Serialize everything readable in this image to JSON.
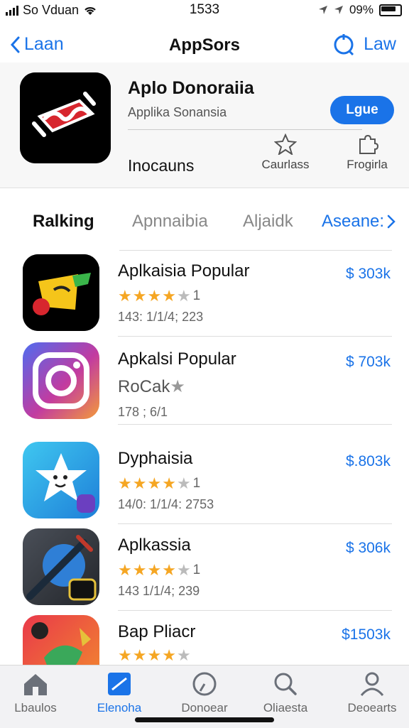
{
  "status_bar": {
    "carrier": "So Vduan",
    "time": "1533",
    "battery_percent": "09%"
  },
  "nav": {
    "back_label": "Laan",
    "title": "AppSors",
    "action_label": "Law"
  },
  "app": {
    "name": "Aplo Donoraiia",
    "subtitle": "Applika Sonansia",
    "get_label": "Lgue",
    "category": "Inocauns",
    "actions": [
      {
        "label": "Caurlass",
        "icon": "star-outline-icon"
      },
      {
        "label": "Frogirla",
        "icon": "puzzle-icon"
      }
    ]
  },
  "tabs": {
    "active": "Ralking",
    "tab2": "Apnnaibia",
    "tab3": "Aljaidk",
    "more": "Aseane:"
  },
  "list": [
    {
      "name": "Aplkaisia Popular",
      "stars": 4,
      "rating_count": "1",
      "meta": "143: 1/1/4; 223",
      "price": "$ 303k",
      "icon": "banana-icon"
    },
    {
      "name": "Apkalsi Popular",
      "subtitle": "RoCak",
      "meta": "178 ; 6/1",
      "price": "$ 703k",
      "icon": "camera-icon"
    },
    {
      "name": "Dyphaisia",
      "stars": 4,
      "rating_count": "1",
      "meta": "14/0: 1/1/4: 2753",
      "price": "$.803k",
      "icon": "star-creature-icon"
    },
    {
      "name": "Aplkassia",
      "stars": 4,
      "rating_count": "1",
      "meta": "143 1/1/4; 239",
      "price": "$ 306k",
      "icon": "knife-icon"
    },
    {
      "name": "Bap Pliacr",
      "stars": 4,
      "rating_count": "",
      "meta": "",
      "price": "$1503k",
      "icon": "gift-icon"
    }
  ],
  "tab_bar": [
    {
      "label": "Lbaulos",
      "icon": "house-icon"
    },
    {
      "label": "Elenoha",
      "icon": "note-icon",
      "active": true
    },
    {
      "label": "Donoear",
      "icon": "clock-icon"
    },
    {
      "label": "Oliaesta",
      "icon": "search-icon"
    },
    {
      "label": "Deoearts",
      "icon": "person-icon"
    }
  ],
  "colors": {
    "accent": "#1a73e8",
    "star": "#f5a623"
  }
}
